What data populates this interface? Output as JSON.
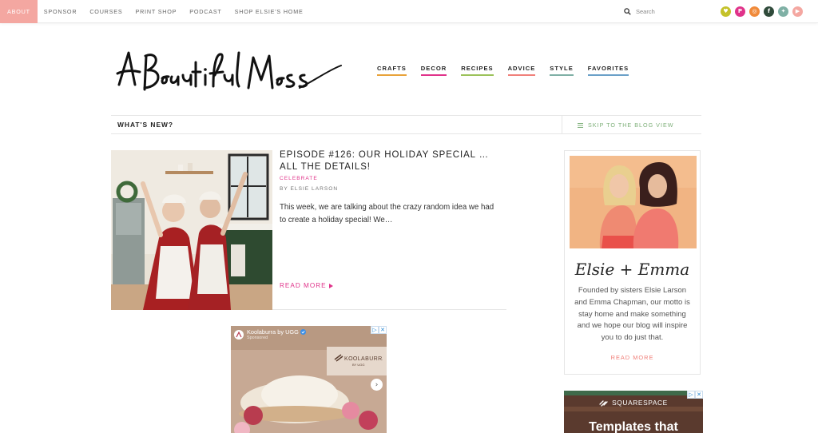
{
  "topnav": {
    "items": [
      {
        "label": "ABOUT",
        "active": true
      },
      {
        "label": "SPONSOR",
        "active": false
      },
      {
        "label": "COURSES",
        "active": false
      },
      {
        "label": "PRINT SHOP",
        "active": false
      },
      {
        "label": "PODCAST",
        "active": false
      },
      {
        "label": "SHOP ELSIE'S HOME",
        "active": false
      }
    ],
    "search_placeholder": "Search",
    "social": [
      {
        "name": "heart-icon",
        "glyph": "♥",
        "color": "#c4c22a"
      },
      {
        "name": "pinterest-icon",
        "glyph": "P",
        "color": "#e0338a"
      },
      {
        "name": "instagram-icon",
        "glyph": "◎",
        "color": "#f08a3a"
      },
      {
        "name": "facebook-icon",
        "glyph": "f",
        "color": "#2f4a3a"
      },
      {
        "name": "twitter-icon",
        "glyph": "✦",
        "color": "#7fb0a5"
      },
      {
        "name": "youtube-icon",
        "glyph": "▶",
        "color": "#f4a7a1"
      }
    ]
  },
  "header": {
    "logo_text": "A Beautiful Mess",
    "nav": [
      {
        "label": "CRAFTS",
        "color": "#e8a23a"
      },
      {
        "label": "DECOR",
        "color": "#e0338a"
      },
      {
        "label": "RECIPES",
        "color": "#9bc25a"
      },
      {
        "label": "ADVICE",
        "color": "#f0807a"
      },
      {
        "label": "STYLE",
        "color": "#7fb0a5"
      },
      {
        "label": "FAVORITES",
        "color": "#6aa0c8"
      }
    ]
  },
  "whats_new": {
    "title": "WHAT'S NEW?",
    "skip_label": "SKIP TO THE BLOG VIEW"
  },
  "post": {
    "title": "EPISODE #126: OUR HOLIDAY SPECIAL … ALL THE DETAILS!",
    "category": "CELEBRATE",
    "author": "BY ELSIE LARSON",
    "excerpt": "This week, we are talking about the crazy random idea we had to create a holiday special! We…",
    "read_more": "READ MORE"
  },
  "ad1": {
    "advertiser": "Koolaburra by UGG",
    "sub": "Sponsored",
    "brand_mark": "KOOLABURRA",
    "brand_sub": "BY UGG"
  },
  "sidebar": {
    "signature": "Elsie + Emma",
    "about": "Founded by sisters Elsie Larson and Emma Chapman, our motto is stay home and make something and we hope our blog will inspire you to do just that.",
    "read_more": "READ MORE"
  },
  "ad2": {
    "brand": "SQUARESPACE",
    "headline": "Templates that"
  }
}
